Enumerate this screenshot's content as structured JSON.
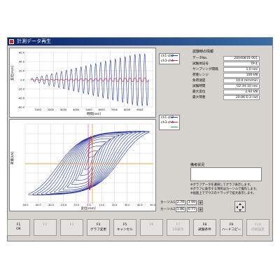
{
  "window": {
    "title": "計測データ再生"
  },
  "top_chart": {
    "ylabel": "変位[mm]",
    "xlabel": "時間[sec]",
    "yticks": [
      "60.0",
      "40.0",
      "20.0",
      "0.0",
      "-20.0",
      "-40.0",
      "-60.0"
    ],
    "xticks": [
      "1000",
      "2000",
      "3000",
      "4000",
      "5000",
      "6000",
      "7000",
      "8000",
      "9000"
    ],
    "legend": [
      {
        "label": "ch1-ch2",
        "color": "#2a3aa0"
      },
      {
        "label": "ch3-ch4",
        "color": "#cc2244"
      }
    ]
  },
  "bottom_chart": {
    "ylabel": "荷重[kN]",
    "xlabel": "変位[mm]",
    "xticks": [
      "-50.0",
      "-40.0",
      "-30.0",
      "-20.0",
      "-10.0",
      "0.0",
      "10.0",
      "20.0",
      "30.0",
      "40.0",
      "50.0"
    ],
    "legend": [
      {
        "label": "ch1-ch2",
        "color": "#2a3aa0"
      },
      {
        "label": "ch3-ch4",
        "color": "#cc2244"
      },
      {
        "label": "",
        "color": "#22aa44"
      }
    ]
  },
  "info": {
    "title": "試験時の情報",
    "rows": [
      {
        "key": "データNo.",
        "value": "20040815-001"
      },
      {
        "key": "試験体記号",
        "value": "TP-1"
      },
      {
        "key": "サンプリング間隔",
        "value": "1.0 sec"
      },
      {
        "key": "荷重レンジ",
        "value": "100 kN"
      },
      {
        "key": "負荷速度",
        "value": "10.0 mm/min"
      },
      {
        "key": "試験時間",
        "value": "02:34:10 sec"
      },
      {
        "key": "最大変位",
        "value": "2.92 kN"
      },
      {
        "key": "最大荷重",
        "value": "20.06 E-3 rad"
      }
    ]
  },
  "remarks": {
    "label": "備考状況",
    "notes": [
      "※グラフデータを選択してグラフ表示します。",
      "※グラフに表示する項目はカーソルで操作します。",
      "※画面上でマウスのドラッグで拡大表示します。"
    ]
  },
  "cursors": [
    {
      "label": "カーソル1",
      "val1": "2.70",
      "val2": "1.99"
    },
    {
      "label": "カーソル2",
      "val1": "1.86",
      "val2": "0.77"
    }
  ],
  "fkeys": [
    {
      "num": "F1",
      "cap": "OK",
      "enabled": true
    },
    {
      "num": "F2",
      "cap": "",
      "enabled": false
    },
    {
      "num": "F3",
      "cap": "",
      "enabled": false
    },
    {
      "num": "F4",
      "cap": "グラフ変更",
      "enabled": true
    },
    {
      "num": "F5",
      "cap": "キャンセル",
      "enabled": true
    },
    {
      "num": "F6",
      "cap": "",
      "enabled": false
    },
    {
      "num": "F7",
      "cap": "3D表示",
      "enabled": false
    },
    {
      "num": "F8",
      "cap": "試験条件",
      "enabled": true
    },
    {
      "num": "F9",
      "cap": "ハードコピー",
      "enabled": true
    },
    {
      "num": "F10",
      "cap": "印刷設定",
      "enabled": false
    }
  ]
}
